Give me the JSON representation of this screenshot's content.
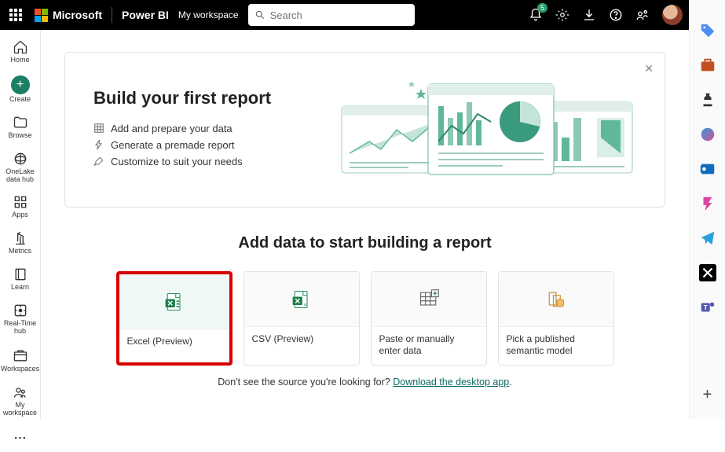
{
  "header": {
    "microsoft": "Microsoft",
    "product": "Power BI",
    "workspace": "My workspace",
    "search_placeholder": "Search",
    "notification_count": "5"
  },
  "leftnav": {
    "home": "Home",
    "create": "Create",
    "browse": "Browse",
    "onelake": "OneLake\ndata hub",
    "apps": "Apps",
    "metrics": "Metrics",
    "learn": "Learn",
    "realtime": "Real-Time\nhub",
    "workspaces": "Workspaces",
    "my_workspace": "My\nworkspace"
  },
  "hero": {
    "title": "Build your first report",
    "steps": {
      "add": "Add and prepare your data",
      "generate": "Generate a premade report",
      "customize": "Customize to suit your needs"
    }
  },
  "section": {
    "title": "Add data to start building a report"
  },
  "cards": {
    "excel": "Excel (Preview)",
    "csv": "CSV (Preview)",
    "paste": "Paste or manually enter data",
    "pick": "Pick a published semantic model"
  },
  "footer": {
    "hint": "Don't see the source you're looking for? ",
    "link": "Download the desktop app"
  }
}
